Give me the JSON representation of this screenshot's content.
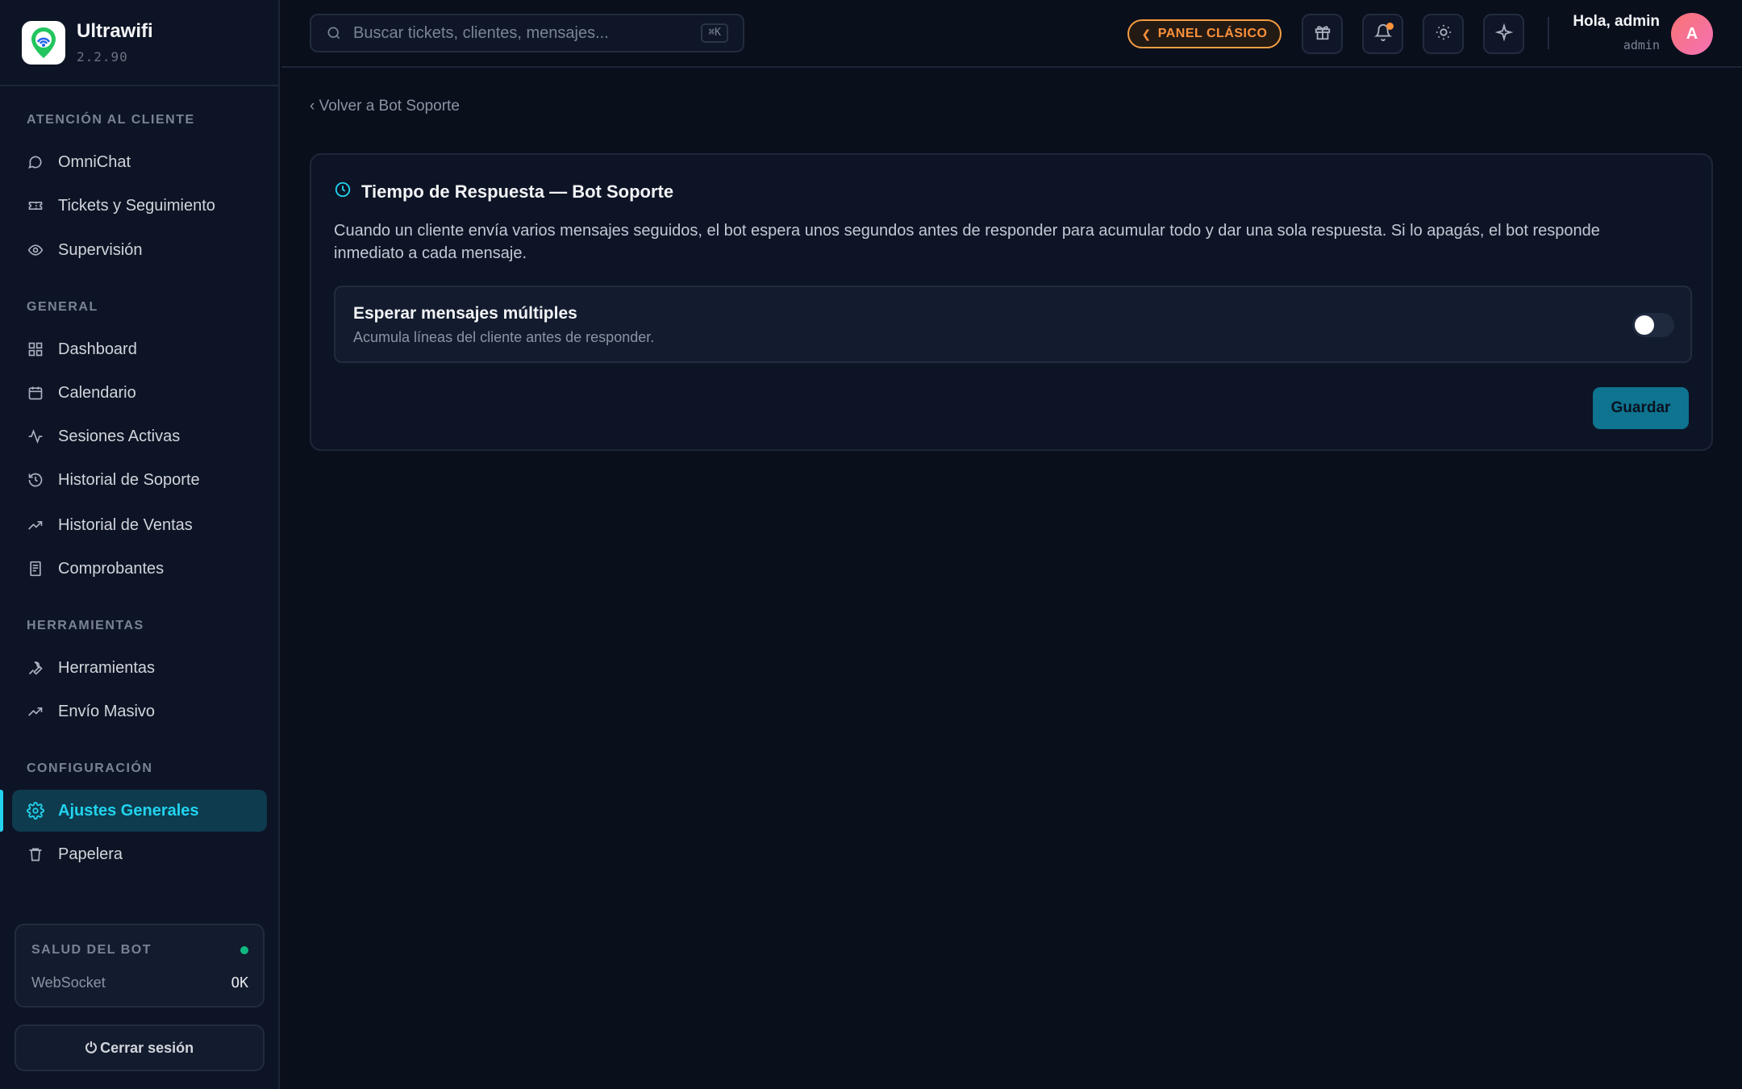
{
  "app": {
    "name": "Ultrawifi",
    "version": "2.2.90"
  },
  "sidebar": {
    "sections": [
      {
        "title": "ATENCIÓN AL CLIENTE",
        "items": [
          {
            "label": "OmniChat",
            "icon": "chat-bubble-icon"
          },
          {
            "label": "Tickets y Seguimiento",
            "icon": "ticket-icon"
          },
          {
            "label": "Supervisión",
            "icon": "eye-icon"
          }
        ]
      },
      {
        "title": "GENERAL",
        "items": [
          {
            "label": "Dashboard",
            "icon": "grid-icon"
          },
          {
            "label": "Calendario",
            "icon": "calendar-icon"
          },
          {
            "label": "Sesiones Activas",
            "icon": "activity-icon"
          },
          {
            "label": "Historial de Soporte",
            "icon": "history-icon"
          },
          {
            "label": "Historial de Ventas",
            "icon": "trending-up-icon"
          },
          {
            "label": "Comprobantes",
            "icon": "receipt-icon"
          }
        ]
      },
      {
        "title": "HERRAMIENTAS",
        "items": [
          {
            "label": "Herramientas",
            "icon": "wrench-icon"
          },
          {
            "label": "Envío Masivo",
            "icon": "trending-up-icon"
          }
        ]
      },
      {
        "title": "CONFIGURACIÓN",
        "items": [
          {
            "label": "Ajustes Generales",
            "icon": "gear-icon",
            "active": true
          },
          {
            "label": "Papelera",
            "icon": "trash-icon"
          }
        ]
      }
    ],
    "health": {
      "title": "SALUD DEL BOT",
      "label": "WebSocket",
      "value": "OK",
      "status_color": "#10b981"
    },
    "logout_label": "Cerrar sesión"
  },
  "topbar": {
    "search_placeholder": "Buscar tickets, clientes, mensajes...",
    "shortcut": "⌘K",
    "classic_label": "PANEL CLÁSICO",
    "greeting": "Hola, admin",
    "role": "admin",
    "avatar_initial": "A"
  },
  "main": {
    "back_link": "‹ Volver a Bot Soporte",
    "card": {
      "title": "Tiempo de Respuesta — Bot Soporte",
      "description": "Cuando un cliente envía varios mensajes seguidos, el bot espera unos segundos antes de responder para acumular todo y dar una sola respuesta. Si lo apagás, el bot responde inmediato a cada mensaje.",
      "option_title": "Esperar mensajes múltiples",
      "option_subtitle": "Acumula líneas del cliente antes de responder.",
      "toggle_on": false,
      "save_label": "Guardar"
    }
  },
  "colors": {
    "accent": "#22d3ee",
    "warning": "#fb923c",
    "background": "#0a0f1c"
  }
}
